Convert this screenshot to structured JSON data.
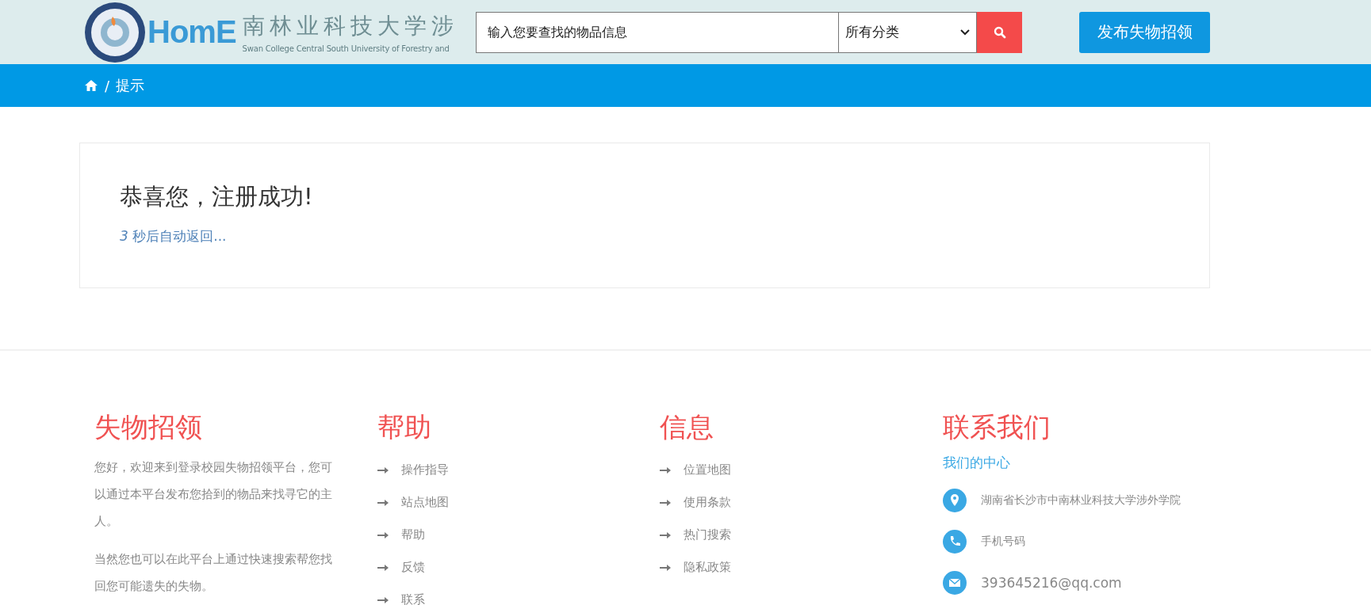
{
  "header": {
    "logo_text": "HomE",
    "school_name": "南林业科技大学涉",
    "school_name_en": "Swan College Central South University of Forestry and",
    "search": {
      "placeholder": "输入您要查找的物品信息",
      "category": "所有分类"
    },
    "publish_button": "发布失物招领"
  },
  "breadcrumb": {
    "separator": "/",
    "current": "提示"
  },
  "notice": {
    "title": "恭喜您，注册成功!",
    "subtitle": "*3* 秒后自动返回..."
  },
  "footer": {
    "about": {
      "heading": "失物招领",
      "paragraphs": [
        "您好，欢迎来到登录校园失物招领平台，您可以通过本平台发布您拾到的物品来找寻它的主人。",
        "当然您也可以在此平台上通过快速搜索帮您找回您可能遗失的失物。"
      ]
    },
    "help": {
      "heading": "帮助",
      "links": [
        "操作指导",
        "站点地图",
        "帮助",
        "反馈",
        "联系"
      ]
    },
    "info": {
      "heading": "信息",
      "links": [
        "位置地图",
        "使用条款",
        "热门搜索",
        "隐私政策"
      ]
    },
    "contact": {
      "heading": "联系我们",
      "subheading": "我们的中心",
      "items": [
        {
          "kind": "location",
          "text": "湖南省长沙市中南林业科技大学涉外学院"
        },
        {
          "kind": "phone",
          "text": "手机号码"
        },
        {
          "kind": "email",
          "text": "393645216@qq.com"
        }
      ]
    }
  }
}
